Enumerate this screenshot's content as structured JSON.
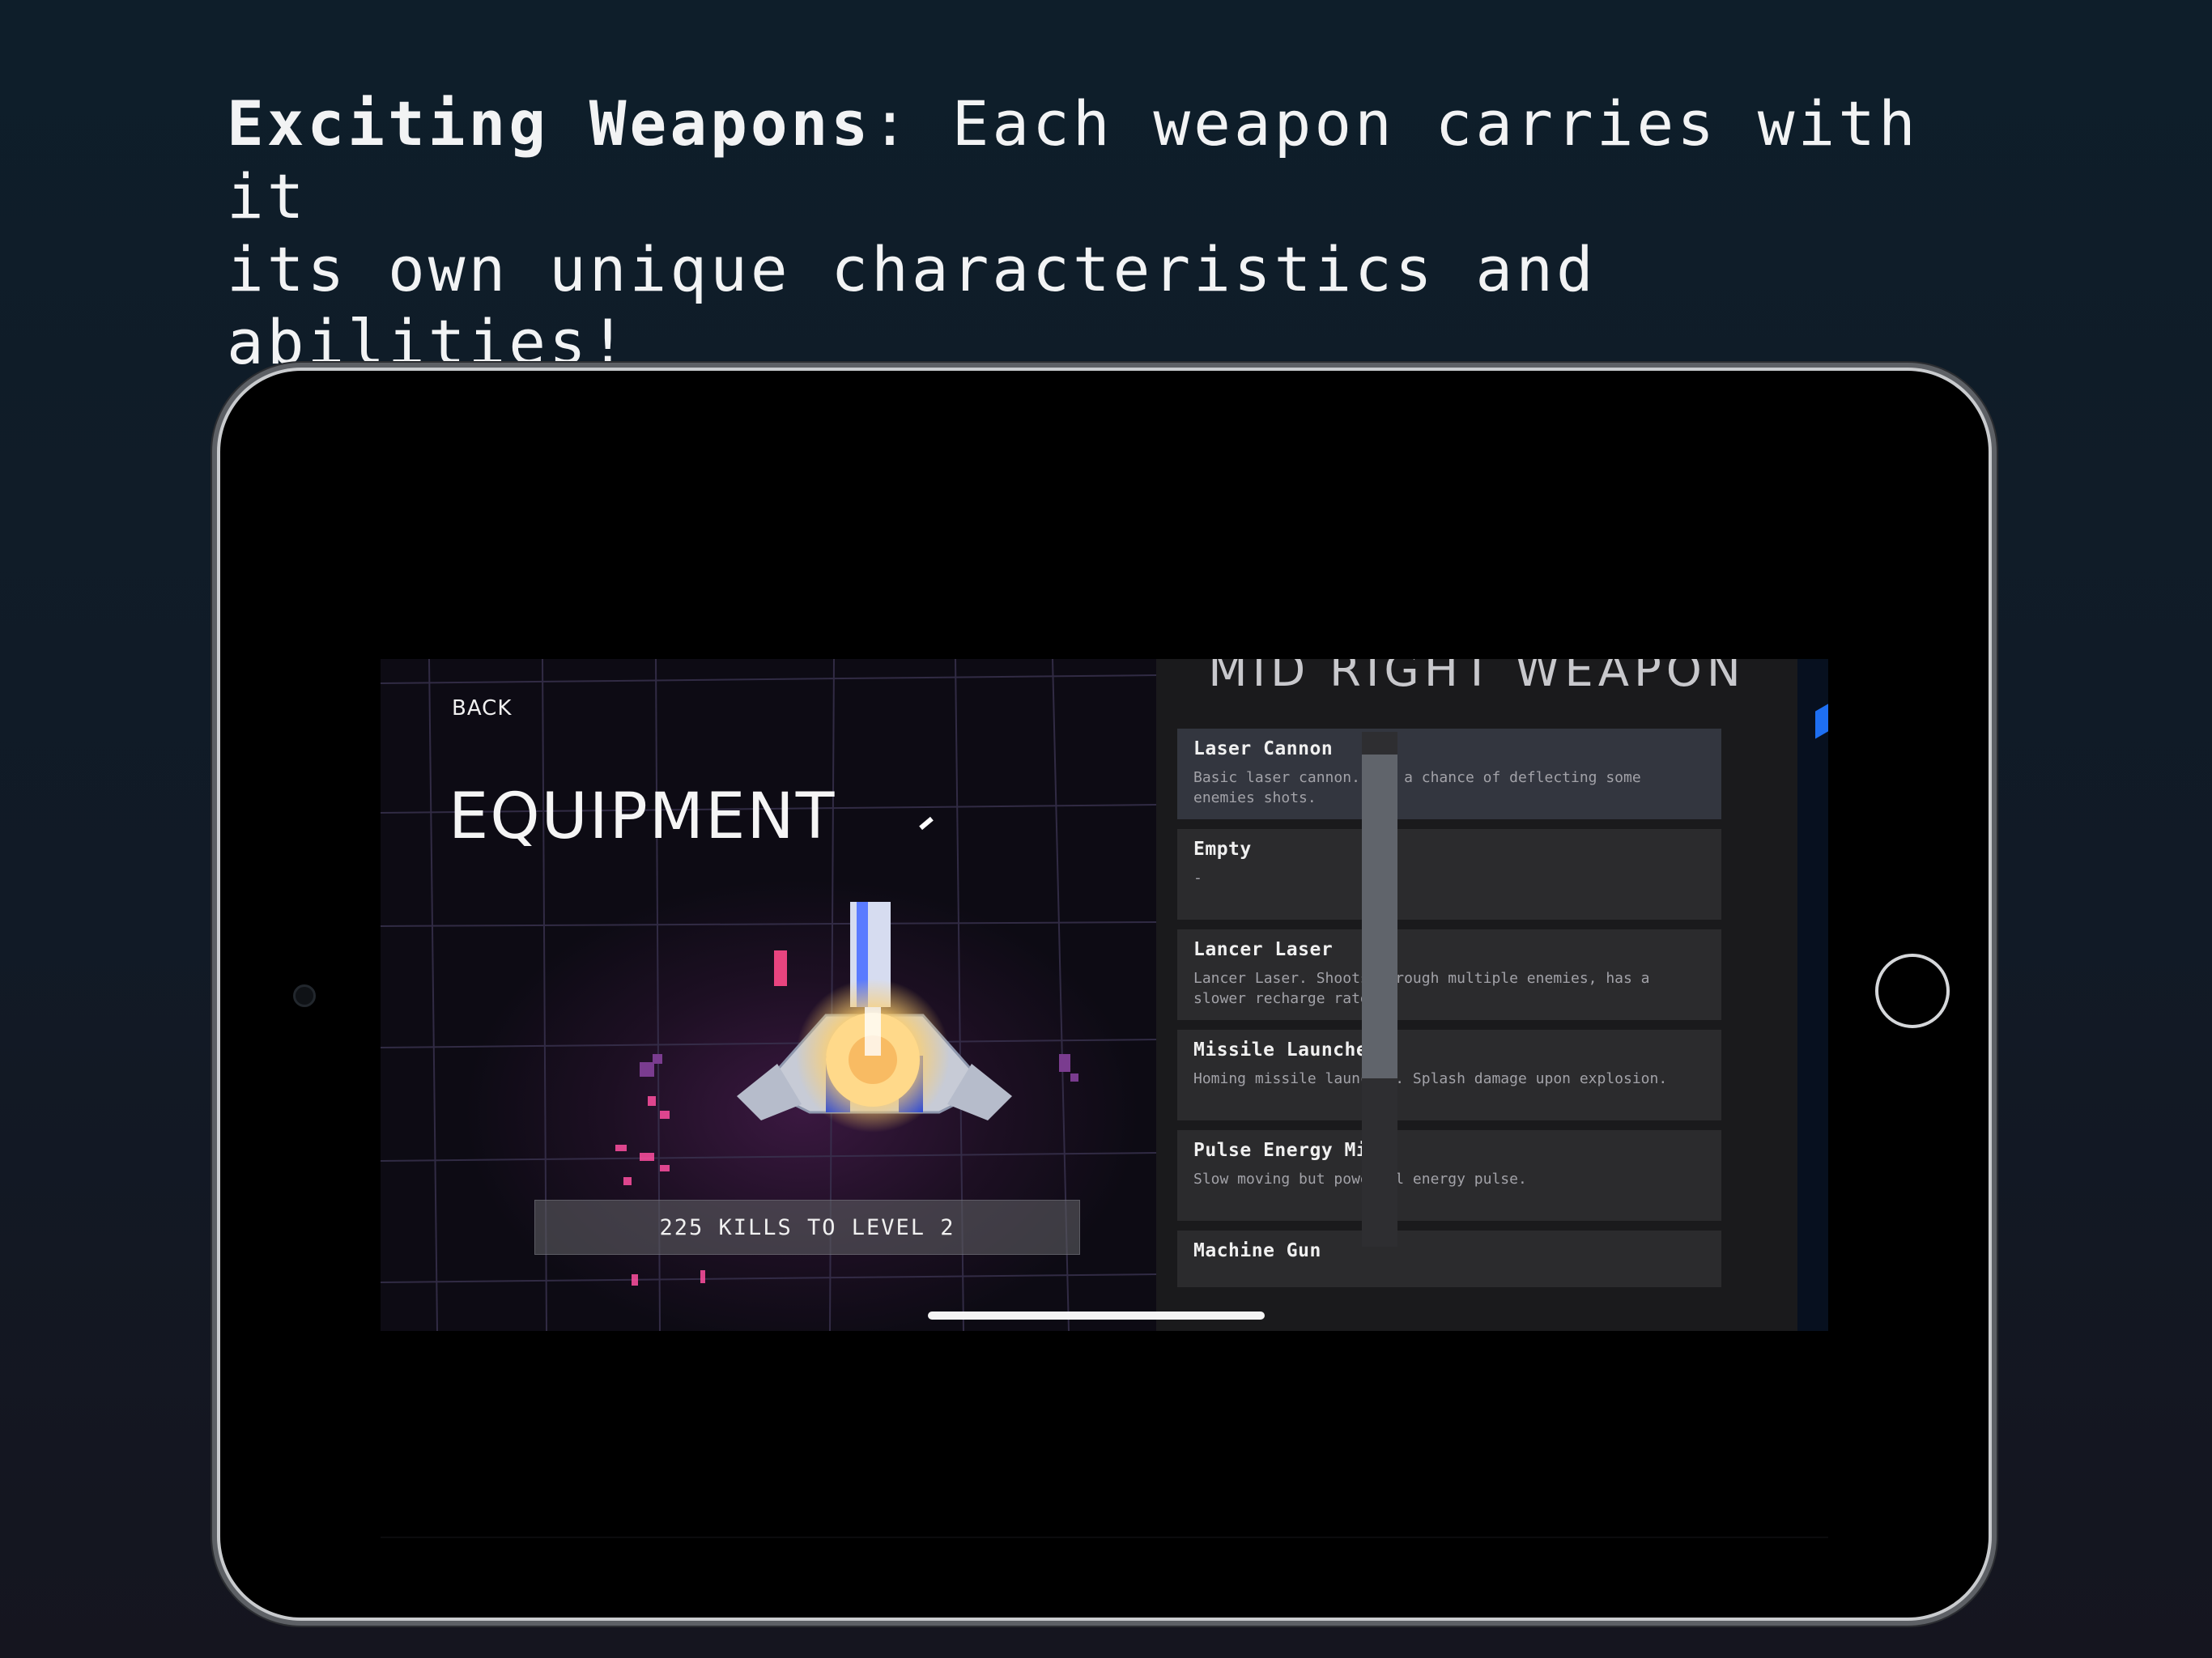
{
  "headline": {
    "bold": "Exciting Weapons",
    "rest": ": Each weapon carries with it\nits own unique characteristics and abilities!"
  },
  "game": {
    "back_label": "BACK",
    "title": "EQUIPMENT",
    "kills_banner": "225 KILLS TO LEVEL 2"
  },
  "weapon_panel": {
    "title": "MID RIGHT WEAPON",
    "items": [
      {
        "name": "Laser Cannon",
        "desc": "Basic laser cannon. Has a chance of deflecting some enemies shots.",
        "selected": true
      },
      {
        "name": "Empty",
        "desc": "-",
        "selected": false
      },
      {
        "name": "Lancer Laser",
        "desc": "Lancer Laser. Shoots through multiple enemies, has a slower recharge rate.",
        "selected": false
      },
      {
        "name": "Missile Launcher",
        "desc": "Homing missile launcher. Splash damage upon explosion.",
        "selected": false
      },
      {
        "name": "Pulse Energy Mine",
        "desc": "Slow moving but powerful energy pulse.",
        "selected": false
      },
      {
        "name": "Machine Gun",
        "desc": "",
        "selected": false
      }
    ]
  },
  "colors": {
    "background": "#0e1e2a",
    "accent_blue": "#1e6ff2",
    "ship_glow": "#ffcf6a",
    "pink_accent": "#ff4fa0"
  }
}
